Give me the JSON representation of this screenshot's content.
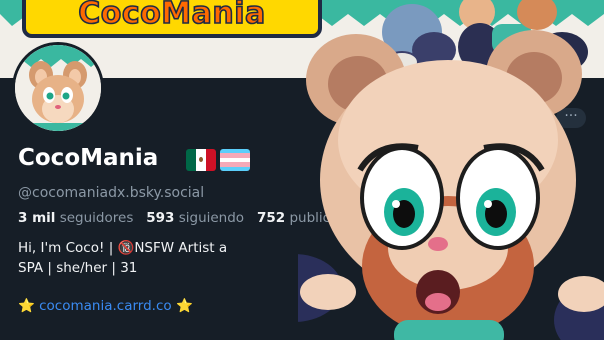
{
  "banner": {
    "logo_text": "CocoMania"
  },
  "profile": {
    "display_name": "CocoMania",
    "flags": [
      "mexico-flag",
      "transgender-flag"
    ],
    "handle": "@cocomaniadx.bsky.social",
    "stats": {
      "followers_count": "3 mil",
      "followers_label": "seguidores",
      "following_count": "593",
      "following_label": "siguiendo",
      "posts_count": "752",
      "posts_label": "publicaciones"
    },
    "bio_lines": [
      "Hi, I'm Coco! | 🔞NSFW Artist a",
      "SPA | she/her | 31"
    ],
    "link_star": "⭐",
    "link_text": "cocomania.carrd.co",
    "more_label": "···"
  },
  "colors": {
    "background": "#161e27",
    "link": "#3a8bf2",
    "muted": "#8b98a5",
    "logo_yellow": "#ffd800",
    "logo_orange": "#ff6a00"
  }
}
